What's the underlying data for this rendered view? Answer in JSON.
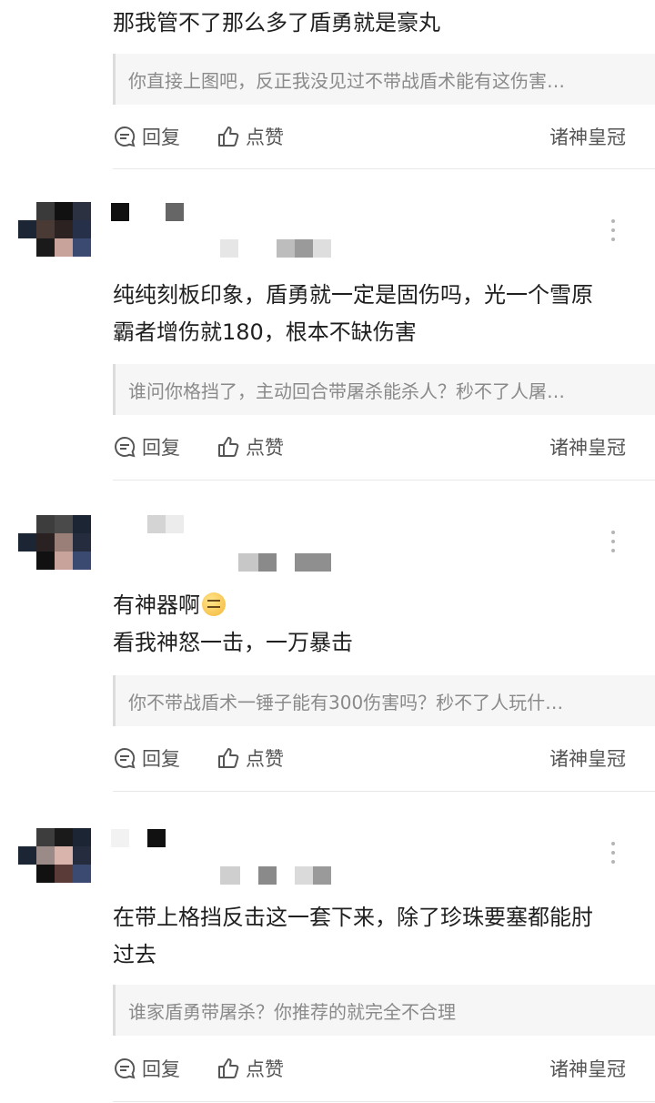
{
  "comments": [
    {
      "text_lines": [
        "那我管不了那么多了盾勇就是豪丸"
      ],
      "quote": "你直接上图吧，反正我没见过不带战盾术能有这伤害…",
      "reply_label": "回复",
      "like_label": "点赞",
      "title": "诸神皇冠"
    },
    {
      "text_lines": [
        "纯纯刻板印象，盾勇就一定是固伤吗，光一个雪原",
        "霸者增伤就180，根本不缺伤害"
      ],
      "quote": "谁问你格挡了，主动回合带屠杀能杀人？秒不了人屠…",
      "reply_label": "回复",
      "like_label": "点赞",
      "title": "诸神皇冠"
    },
    {
      "text_lines": [
        "有神器啊",
        "看我神怒一击，一万暴击"
      ],
      "quote": "你不带战盾术一锤子能有300伤害吗？秒不了人玩什…",
      "reply_label": "回复",
      "like_label": "点赞",
      "title": "诸神皇冠"
    },
    {
      "text_lines": [
        "在带上格挡反击这一套下来，除了珍珠要塞都能肘",
        "过去"
      ],
      "quote": "谁家盾勇带屠杀？你推荐的就完全不合理",
      "reply_label": "回复",
      "like_label": "点赞",
      "title": "诸神皇冠"
    }
  ],
  "icons": {
    "reply": "reply-bubble-icon",
    "like": "thumbs-up-icon",
    "more": "more-vertical-icon",
    "emoji": "smiling-face-emoji"
  },
  "colors": {
    "text": "#1f1f1f",
    "secondary": "#555555",
    "quote_text": "#8a8a8a",
    "quote_bg": "#f6f6f6"
  }
}
